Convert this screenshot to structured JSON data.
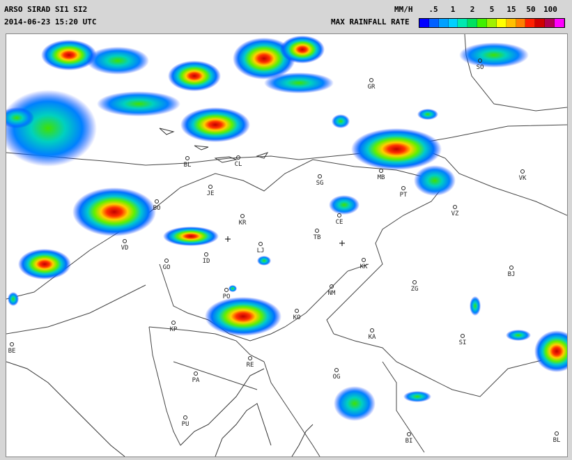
{
  "header": {
    "title": "ARSO SIRAD SI1 SI2",
    "timestamp": "2014-06-23 15:20 UTC",
    "unit": "MM/H",
    "legend_title": "MAX RAINFALL RATE"
  },
  "legend": {
    "ticks": [
      ".5",
      "1",
      "2",
      "5",
      "15",
      "50",
      "100"
    ],
    "colors": [
      "#0000ff",
      "#0060ff",
      "#00a0ff",
      "#00d0ff",
      "#00e8b0",
      "#00e060",
      "#40f000",
      "#a0f000",
      "#ffff00",
      "#ffc000",
      "#ff8000",
      "#ff2000",
      "#d00000",
      "#b00050",
      "#ff00ff"
    ]
  },
  "cities": [
    {
      "label": "GR"
    },
    {
      "label": "SO"
    },
    {
      "label": "BL"
    },
    {
      "label": "CL"
    },
    {
      "label": "MB"
    },
    {
      "label": "SG"
    },
    {
      "label": "JE"
    },
    {
      "label": "PT"
    },
    {
      "label": "VK"
    },
    {
      "label": "BO"
    },
    {
      "label": "KR"
    },
    {
      "label": "CE"
    },
    {
      "label": "VZ"
    },
    {
      "label": "TB"
    },
    {
      "label": "VD"
    },
    {
      "label": "LJ"
    },
    {
      "label": "ID"
    },
    {
      "label": "GO"
    },
    {
      "label": "KK"
    },
    {
      "label": "BJ"
    },
    {
      "label": "ZG"
    },
    {
      "label": "NM"
    },
    {
      "label": "PO"
    },
    {
      "label": "KO"
    },
    {
      "label": "KP"
    },
    {
      "label": "KA"
    },
    {
      "label": "SI"
    },
    {
      "label": "BE"
    },
    {
      "label": "RE"
    },
    {
      "label": "PA"
    },
    {
      "label": "OG"
    },
    {
      "label": "PU"
    },
    {
      "label": "BI"
    },
    {
      "label": "BL"
    }
  ]
}
